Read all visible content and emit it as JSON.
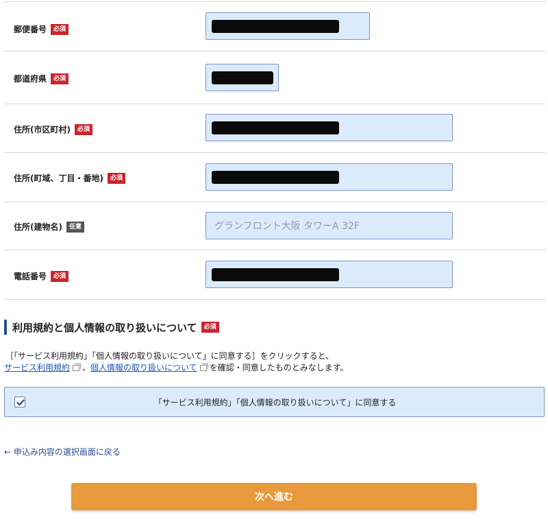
{
  "form": {
    "required_badge": "必須",
    "optional_badge": "任意",
    "rows": [
      {
        "label": "郵便番号",
        "badge": "必須",
        "value": "",
        "placeholder": ""
      },
      {
        "label": "都道府県",
        "badge": "必須",
        "value": "",
        "placeholder": ""
      },
      {
        "label": "住所(市区町村)",
        "badge": "必須",
        "value": "",
        "placeholder": ""
      },
      {
        "label": "住所(町域、丁目・番地)",
        "badge": "必須",
        "value": "",
        "placeholder": ""
      },
      {
        "label": "住所(建物名)",
        "badge": "任意",
        "value": "",
        "placeholder": "グランフロント大阪 タワーA 32F"
      },
      {
        "label": "電話番号",
        "badge": "必須",
        "value": "",
        "placeholder": ""
      }
    ]
  },
  "terms": {
    "title": "利用規約と個人情報の取り扱いについて",
    "badge": "必須",
    "line1": "［「サービス利用規約」「個人情報の取り扱いについて」に同意する］をクリックすると、",
    "link1": "サービス利用規約",
    "separator": "、",
    "link2": "個人情報の取り扱いについて",
    "line2_suffix": "を確認・同意したものとみなします。",
    "agree_label": "「サービス利用規約」「個人情報の取り扱いについて」に同意する",
    "agree_checked": true
  },
  "back_link": "← 申込み内容の選択画面に戻る",
  "next_button": "次へ進む",
  "colors": {
    "required_badge": "#c8262c",
    "optional_badge": "#555555",
    "field_bg": "#dcebfc",
    "button": "#e99a3c",
    "link": "#1a56b8"
  }
}
